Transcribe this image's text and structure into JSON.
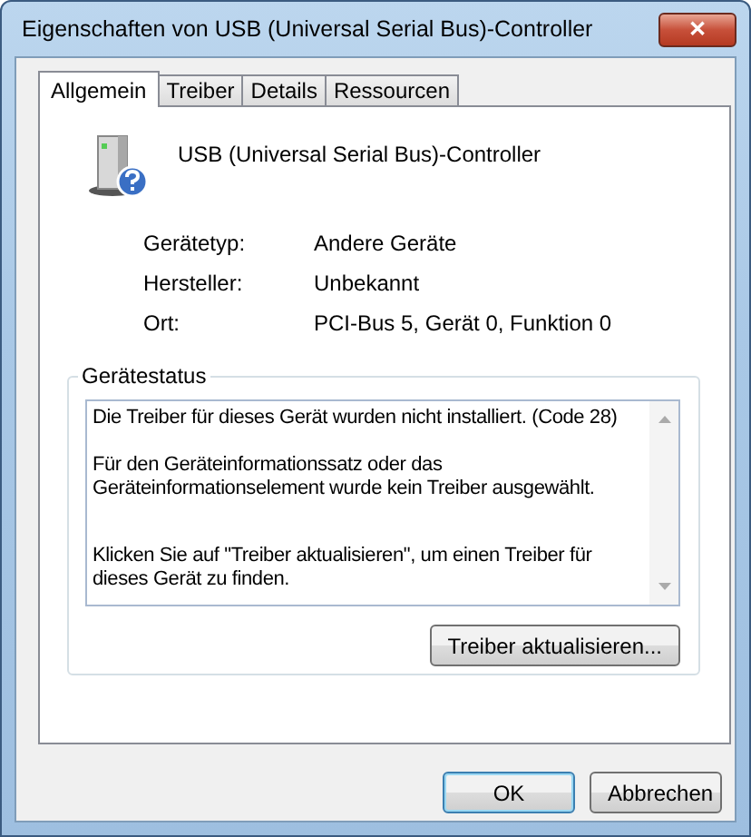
{
  "window": {
    "title": "Eigenschaften von USB (Universal Serial Bus)-Controller",
    "close": "✕"
  },
  "tabs": [
    {
      "label": "Allgemein",
      "selected": true
    },
    {
      "label": "Treiber",
      "selected": false
    },
    {
      "label": "Details",
      "selected": false
    },
    {
      "label": "Ressourcen",
      "selected": false
    }
  ],
  "device_name": "USB (Universal Serial Bus)-Controller",
  "properties": [
    {
      "label": "Gerätetyp:",
      "value": "Andere Geräte"
    },
    {
      "label": "Hersteller:",
      "value": "Unbekannt"
    },
    {
      "label": "Ort:",
      "value": "PCI-Bus 5, Gerät 0, Funktion 0"
    }
  ],
  "device_status": {
    "title": "Gerätestatus",
    "paragraphs": [
      "Die Treiber für dieses Gerät wurden nicht installiert. (Code 28)",
      "Für den Geräteinformationssatz oder das Geräteinformationselement wurde kein Treiber ausgewählt.",
      "Klicken Sie auf \"Treiber aktualisieren\", um einen Treiber für dieses Gerät zu finden."
    ],
    "button": "Treiber aktualisieren..."
  },
  "buttons": [
    {
      "label": "OK",
      "default": true
    },
    {
      "label": "Abbrechen",
      "default": false
    }
  ]
}
